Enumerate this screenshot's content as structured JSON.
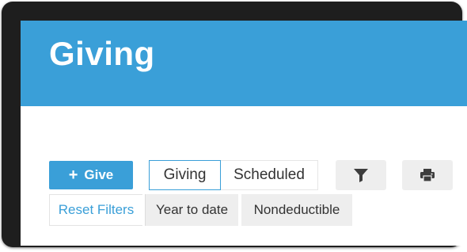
{
  "page": {
    "title": "Giving"
  },
  "toolbar": {
    "give_label": "Give",
    "give_icon": "+",
    "tabs": [
      {
        "label": "Giving",
        "selected": true
      },
      {
        "label": "Scheduled",
        "selected": false
      }
    ],
    "filter_icon": "filter-icon",
    "print_icon": "print-icon"
  },
  "filters": {
    "reset_label": "Reset Filters",
    "chips": [
      {
        "label": "Year to date"
      },
      {
        "label": "Nondeductible"
      }
    ]
  },
  "colors": {
    "accent": "#3a9fd8",
    "header_bg": "#3a9fd8",
    "chip_bg": "#eeeeee",
    "frame": "#1e1e1e"
  }
}
